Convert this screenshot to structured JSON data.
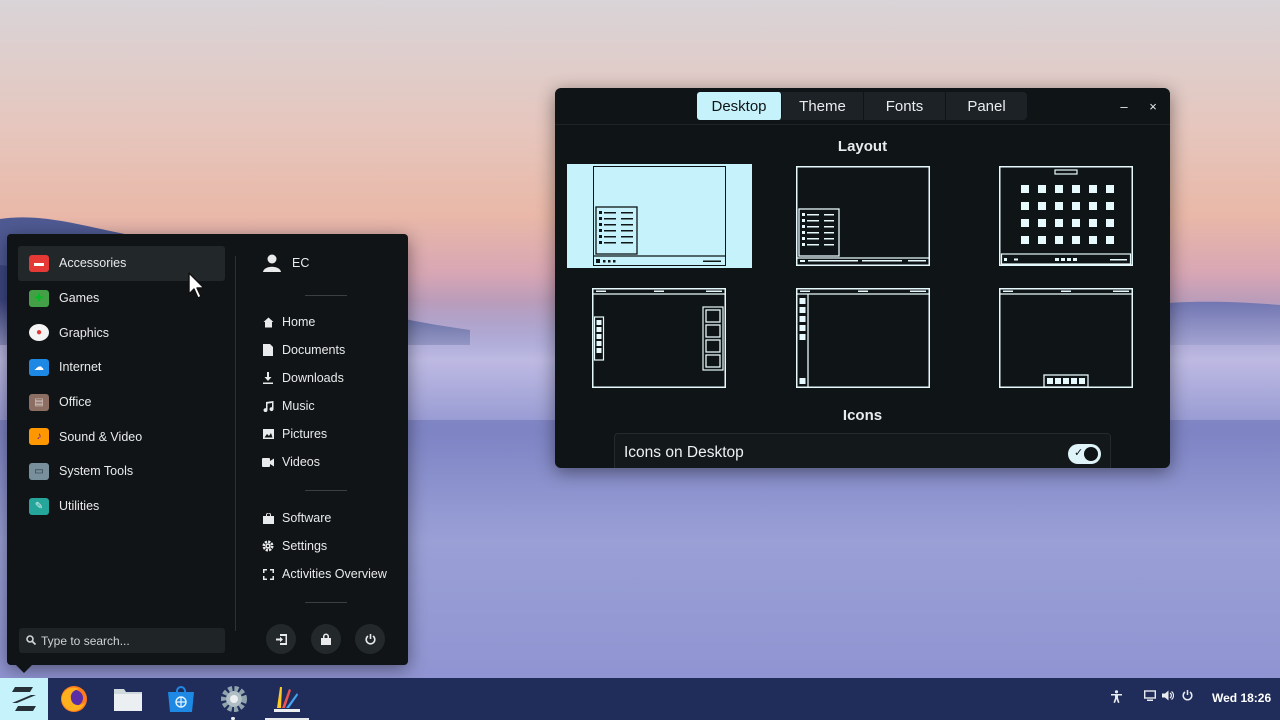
{
  "menu": {
    "categories": [
      {
        "label": "Accessories",
        "icon": "accessories-icon",
        "color": "#e53935"
      },
      {
        "label": "Games",
        "icon": "games-icon",
        "color": "#43a047"
      },
      {
        "label": "Graphics",
        "icon": "graphics-icon",
        "color": "#f4f4f4"
      },
      {
        "label": "Internet",
        "icon": "internet-icon",
        "color": "#1e88e5"
      },
      {
        "label": "Office",
        "icon": "office-icon",
        "color": "#8d6e63"
      },
      {
        "label": "Sound & Video",
        "icon": "sound-video-icon",
        "color": "#ff9800"
      },
      {
        "label": "System Tools",
        "icon": "system-tools-icon",
        "color": "#78909c"
      },
      {
        "label": "Utilities",
        "icon": "utilities-icon",
        "color": "#26a69a"
      }
    ],
    "user": "EC",
    "places": [
      "Home",
      "Documents",
      "Downloads",
      "Music",
      "Pictures",
      "Videos"
    ],
    "apps": [
      "Software",
      "Settings",
      "Activities Overview"
    ],
    "search_placeholder": "Type to search..."
  },
  "window": {
    "tabs": [
      "Desktop",
      "Theme",
      "Fonts",
      "Panel"
    ],
    "selected_tab": "Desktop",
    "section_layout": "Layout",
    "section_icons": "Icons",
    "icons_on_desktop_label": "Icons on Desktop",
    "icons_on_desktop": true,
    "minimize": "–",
    "close": "×"
  },
  "taskbar": {
    "clock": "Wed 18:26",
    "accent": "#c6f3fb"
  }
}
